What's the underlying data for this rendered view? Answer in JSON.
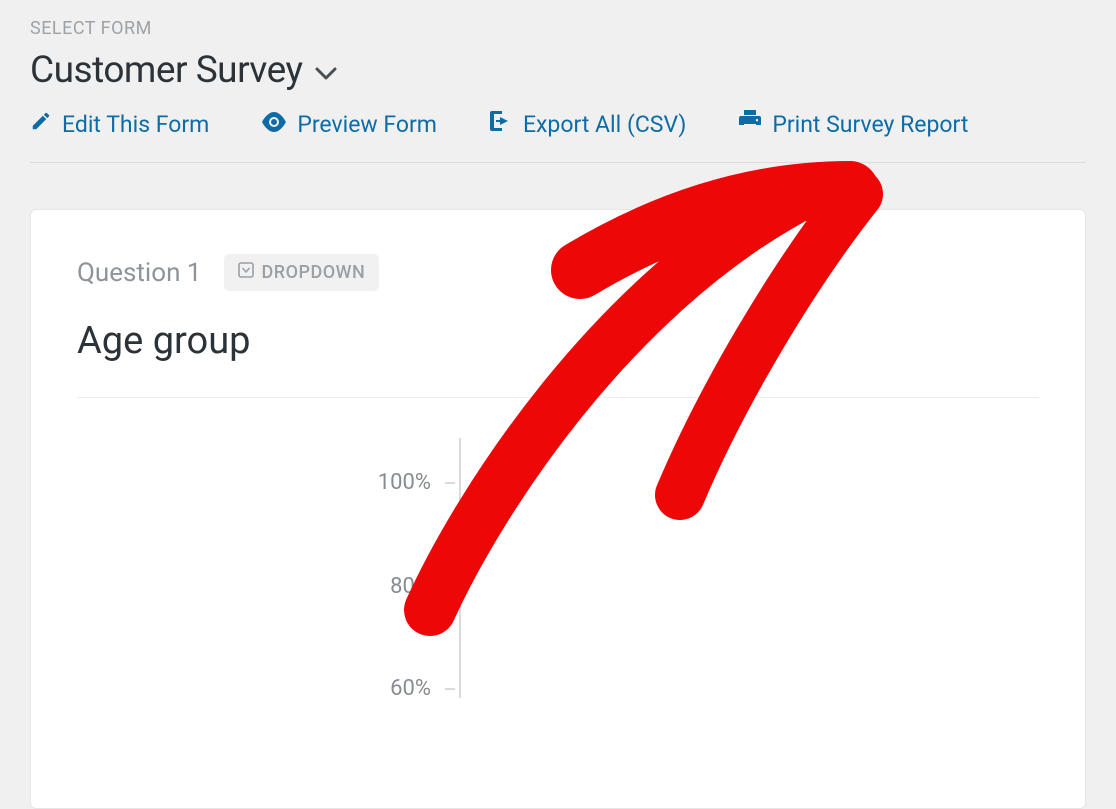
{
  "header": {
    "select_form_label": "SELECT FORM",
    "form_name": "Customer Survey"
  },
  "actions": {
    "edit": "Edit This Form",
    "preview": "Preview Form",
    "export": "Export All (CSV)",
    "print": "Print Survey Report"
  },
  "card": {
    "question_number": "Question 1",
    "badge_label": "DROPDOWN",
    "question_title": "Age group"
  },
  "chart_data": {
    "type": "bar",
    "title": "Age group",
    "ylabel": "",
    "xlabel": "",
    "ylim": [
      0,
      100
    ],
    "ticks": [
      "100%",
      "80%",
      "60%"
    ]
  },
  "annotation": {
    "arrow_color": "#ee0707"
  }
}
